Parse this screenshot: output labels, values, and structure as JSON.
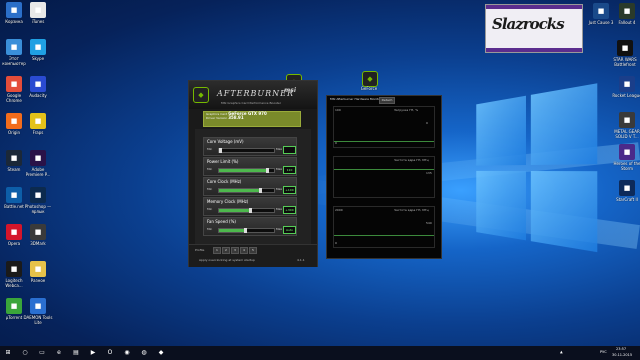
{
  "desktop": {
    "left_icons": [
      {
        "label": "Корзина",
        "icon": "recycle-bin-icon",
        "color": "#2b6fc9"
      },
      {
        "label": "iTunes",
        "icon": "itunes-icon",
        "color": "#e8e8e8"
      },
      {
        "label": "Этот компьютер",
        "icon": "computer-icon",
        "color": "#3a8fd9"
      },
      {
        "label": "Skype",
        "icon": "skype-icon",
        "color": "#1fa0e3"
      },
      {
        "label": "Google Chrome",
        "icon": "chrome-icon",
        "color": "#e44d3a"
      },
      {
        "label": "Audacity",
        "icon": "audacity-icon",
        "color": "#2a4bd1"
      },
      {
        "label": "Origin",
        "icon": "origin-icon",
        "color": "#f26c1c"
      },
      {
        "label": "Fraps",
        "icon": "fraps-icon",
        "color": "#e3c21a"
      },
      {
        "label": "Steam",
        "icon": "steam-icon",
        "color": "#1b2838"
      },
      {
        "label": "Adobe Premiere P...",
        "icon": "premiere-icon",
        "color": "#2a1248"
      },
      {
        "label": "Battle.net",
        "icon": "battlenet-icon",
        "color": "#0d5ea8"
      },
      {
        "label": "Photoshop — ярлык",
        "icon": "photoshop-icon",
        "color": "#0c2a4e"
      },
      {
        "label": "Opera",
        "icon": "opera-icon",
        "color": "#d4152b"
      },
      {
        "label": "3DMark",
        "icon": "3dmark-icon",
        "color": "#3a3a3a"
      },
      {
        "label": "Logitech Webca...",
        "icon": "logitech-icon",
        "color": "#1a1a1a"
      },
      {
        "label": "Разное",
        "icon": "folder-icon",
        "color": "#e6c24a"
      },
      {
        "label": "µTorrent",
        "icon": "utorrent-icon",
        "color": "#3aa53a"
      },
      {
        "label": "DAEMON Tools Lite",
        "icon": "daemon-tools-icon",
        "color": "#2a6fd1"
      }
    ],
    "right_icons": [
      {
        "label": "Just Cause 3",
        "icon": "just-cause-icon",
        "color": "#1a4a8a"
      },
      {
        "label": "Fallout 4",
        "icon": "fallout-icon",
        "color": "#2a3a2a"
      },
      {
        "label": "STAR WARS Battlefront",
        "icon": "battlefront-icon",
        "color": "#111111"
      },
      {
        "label": "Rocket League",
        "icon": "rocket-league-icon",
        "color": "#1a3e8a"
      },
      {
        "label": "METAL GEAR SOLID V T...",
        "icon": "mgs-icon",
        "color": "#3a3a3a"
      },
      {
        "label": "Heroes of the Storm",
        "icon": "heroes-icon",
        "color": "#4a2a8a"
      },
      {
        "label": "StarCraft II",
        "icon": "starcraft-icon",
        "color": "#0d2a5a"
      }
    ],
    "floating_icon_label": "GeForce"
  },
  "afterburner": {
    "title": "AFTERBURNER",
    "brand": "msi",
    "subtitle": "MSI Graphics Card Performance Booster",
    "gpu_label": "Graphics Card",
    "gpu_name": "GeForce GTX 970",
    "driver_label": "Driver Version",
    "driver_version": "358.91",
    "sliders": [
      {
        "name": "Core Voltage (mV)",
        "min": "Min",
        "max": "Max",
        "value": "",
        "fill": 0.0
      },
      {
        "name": "Power Limit (%)",
        "min": "Min",
        "max": "Max",
        "value": "110",
        "fill": 0.85
      },
      {
        "name": "Core Clock (MHz)",
        "min": "Min",
        "max": "Max",
        "value": "+100",
        "fill": 0.72
      },
      {
        "name": "Memory Clock (MHz)",
        "min": "Min",
        "max": "Max",
        "value": "+300",
        "fill": 0.55
      },
      {
        "name": "Fan Speed (%)",
        "min": "Min",
        "max": "Max",
        "value": "Auto",
        "fill": 0.45
      }
    ],
    "profile_label": "Profile",
    "profile_slots": [
      "1",
      "2",
      "3",
      "4",
      "5"
    ],
    "startup_text": "Apply overclocking at system startup",
    "version": "4.1.1",
    "accent_color": "#4db84d"
  },
  "monitor": {
    "title": "MSI Afterburner Hardware Monitor",
    "detach_label": "Detach",
    "graphs": [
      {
        "label": "Загрузка ГП, %",
        "top": "100",
        "bottom": "0",
        "value": "0"
      },
      {
        "label": "Частота ядра ГП, МГц",
        "top": "",
        "bottom": "",
        "value": "135"
      },
      {
        "label": "Частота ядра ГП, МГц",
        "top": "2000",
        "bottom": "0",
        "value": "540"
      }
    ],
    "line_color": "#3c8a3c"
  },
  "logo": {
    "text": "Slazrocks"
  },
  "taskbar": {
    "language": "РУС",
    "time": "23:57",
    "date": "30.11.2015",
    "items": [
      "start-icon",
      "search-icon",
      "task-view-icon",
      "edge-icon",
      "explorer-icon",
      "media-icon",
      "opera-icon",
      "chrome-icon",
      "steam-icon",
      "afterburner-icon"
    ]
  }
}
